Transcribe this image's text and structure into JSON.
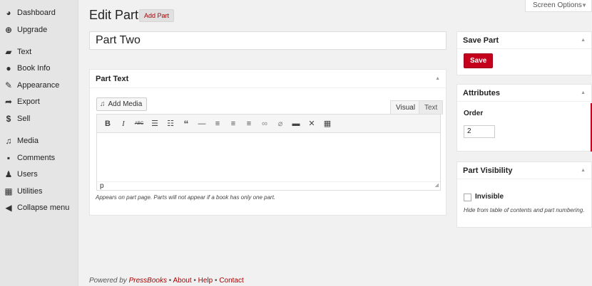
{
  "sidebar": {
    "items": [
      {
        "label": "Dashboard",
        "icon": "dashboard-icon"
      },
      {
        "label": "Upgrade",
        "icon": "upgrade-icon"
      },
      {
        "label": "Text",
        "icon": "book-icon"
      },
      {
        "label": "Book Info",
        "icon": "info-icon"
      },
      {
        "label": "Appearance",
        "icon": "brush-icon"
      },
      {
        "label": "Export",
        "icon": "export-icon"
      },
      {
        "label": "Sell",
        "icon": "dollar-icon"
      },
      {
        "label": "Media",
        "icon": "media-icon"
      },
      {
        "label": "Comments",
        "icon": "comment-icon"
      },
      {
        "label": "Users",
        "icon": "user-icon"
      },
      {
        "label": "Utilities",
        "icon": "utilities-icon"
      },
      {
        "label": "Collapse menu",
        "icon": "collapse-icon"
      }
    ]
  },
  "header": {
    "title": "Edit Part",
    "add_button": "Add Part",
    "screen_options": "Screen Options"
  },
  "title_field": {
    "value": "Part Two"
  },
  "part_text": {
    "heading": "Part Text",
    "add_media": "Add Media",
    "tab_visual": "Visual",
    "tab_text": "Text",
    "path": "p",
    "description": "Appears on part page. Parts will not appear if a book has only one part."
  },
  "save_part": {
    "heading": "Save Part",
    "save_label": "Save"
  },
  "attributes": {
    "heading": "Attributes",
    "order_label": "Order",
    "order_value": "2"
  },
  "visibility": {
    "heading": "Part Visibility",
    "invisible_label": "Invisible",
    "description": "Hide from table of contents and part numbering."
  },
  "footer": {
    "powered": "Powered by ",
    "brand": "PressBooks",
    "sep": " • ",
    "about": "About",
    "help": "Help",
    "contact": "Contact"
  },
  "colors": {
    "accent": "#c4001d",
    "sidebar_bg": "#e5e5e5",
    "page_bg": "#f1f1f1"
  }
}
